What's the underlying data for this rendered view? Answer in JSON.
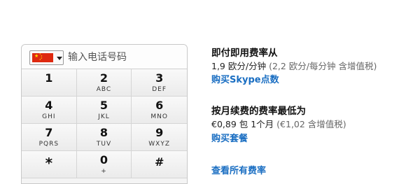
{
  "phone": {
    "placeholder": "输入电话号码",
    "flag_icon": "china-flag-icon",
    "dropdown_icon": "caret-down-icon"
  },
  "keypad": [
    {
      "num": "1",
      "letters": ""
    },
    {
      "num": "2",
      "letters": "ABC"
    },
    {
      "num": "3",
      "letters": "DEF"
    },
    {
      "num": "4",
      "letters": "GHI"
    },
    {
      "num": "5",
      "letters": "JKL"
    },
    {
      "num": "6",
      "letters": "MNO"
    },
    {
      "num": "7",
      "letters": "PQRS"
    },
    {
      "num": "8",
      "letters": "TUV"
    },
    {
      "num": "9",
      "letters": "WXYZ"
    },
    {
      "num": "*",
      "letters": ""
    },
    {
      "num": "0",
      "letters": "+"
    },
    {
      "num": "#",
      "letters": ""
    }
  ],
  "payg": {
    "title": "即付即用费率从",
    "rate": "1,9 欧分/分钟",
    "rate_note": "(2,2 欧分/每分钟 含增值税)",
    "link": "购买Skype点数"
  },
  "monthly": {
    "title": "按月续费的费率最低为",
    "rate": "€0,89 包 1个月",
    "rate_note": "(€1,02 含增值税)",
    "link": "购买套餐"
  },
  "all_rates_link": "查看所有费率",
  "colors": {
    "link": "#1a6ec2",
    "flag_red": "#de2910",
    "flag_star": "#ffde00"
  }
}
